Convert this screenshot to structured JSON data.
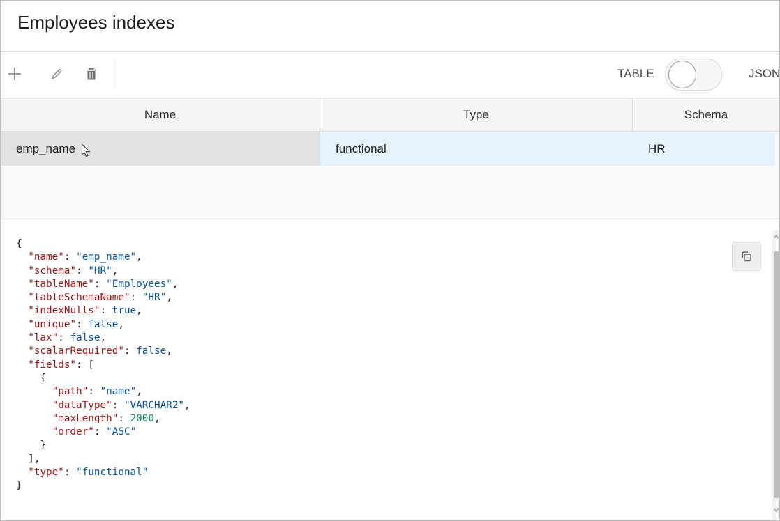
{
  "panel": {
    "title": "Employees indexes"
  },
  "toolbar": {
    "add_icon": "plus-icon",
    "edit_icon": "pencil-icon",
    "delete_icon": "trash-icon",
    "view_toggle": {
      "left_label": "TABLE",
      "right_label": "JSON",
      "selected": "TABLE"
    }
  },
  "table": {
    "columns": [
      "Name",
      "Type",
      "Schema"
    ],
    "rows": [
      {
        "name": "emp_name",
        "type": "functional",
        "schema": "HR"
      }
    ]
  },
  "json_view": {
    "copy_icon": "copy-icon",
    "content": {
      "name": "emp_name",
      "schema": "HR",
      "tableName": "Employees",
      "tableSchemaName": "HR",
      "indexNulls": true,
      "unique": false,
      "lax": false,
      "scalarRequired": false,
      "fields": [
        {
          "path": "name",
          "dataType": "VARCHAR2",
          "maxLength": 2000,
          "order": "ASC"
        }
      ],
      "type": "functional"
    }
  },
  "colors": {
    "selected_row_bg": "#e6f3fb",
    "hover_cell_bg": "#e3e3e3",
    "json_key": "#a31515",
    "json_string": "#0451a5",
    "json_number": "#098658"
  }
}
